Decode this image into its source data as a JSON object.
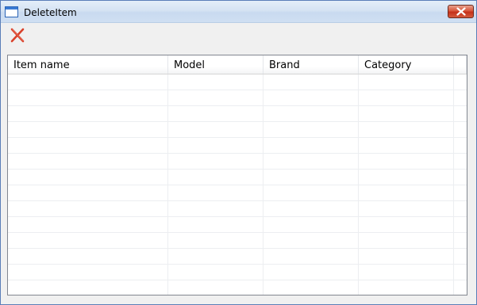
{
  "window": {
    "title": "DeleteItem",
    "app_icon": "window-icon",
    "close_icon": "close-icon"
  },
  "toolbar": {
    "delete_icon": "red-x-delete-icon",
    "delete_color": "#d9412b"
  },
  "table": {
    "columns": [
      {
        "label": "Item name"
      },
      {
        "label": "Model"
      },
      {
        "label": "Brand"
      },
      {
        "label": "Category"
      },
      {
        "label": ""
      }
    ],
    "rows": []
  }
}
